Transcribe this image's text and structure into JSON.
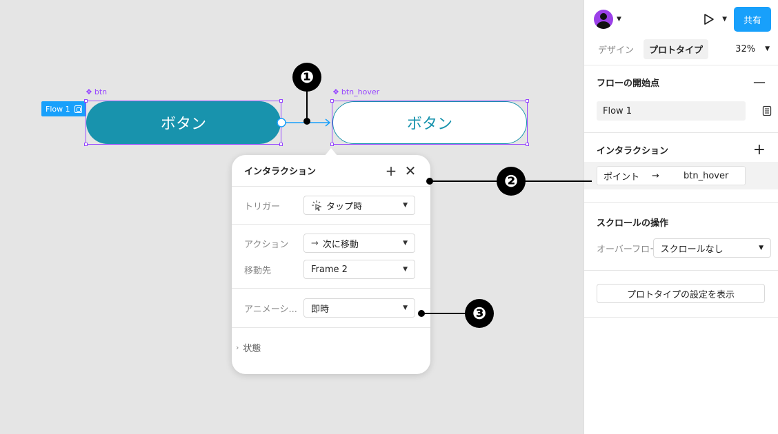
{
  "canvas": {
    "flow_tag": "Flow 1",
    "components": [
      {
        "name": "btn",
        "label": "ボタン"
      },
      {
        "name": "btn_hover",
        "label": "ボタン"
      }
    ],
    "callouts": [
      "❶",
      "❷",
      "❸"
    ]
  },
  "popup": {
    "title": "インタラクション",
    "trigger_label": "トリガー",
    "trigger_value": "タップ時",
    "action_label": "アクション",
    "action_value": "次に移動",
    "destination_label": "移動先",
    "destination_value": "Frame 2",
    "animation_label": "アニメーシ...",
    "animation_value": "即時",
    "state_label": "状態"
  },
  "panel": {
    "tabs": [
      "デザイン",
      "プロトタイプ"
    ],
    "active_tab": "プロトタイプ",
    "zoom": "32%",
    "share_label": "共有",
    "flow_section_title": "フローの開始点",
    "flow_name": "Flow 1",
    "interaction_section_title": "インタラクション",
    "interaction_item": {
      "trigger": "ポイント",
      "target": "btn_hover"
    },
    "scroll_section_title": "スクロールの操作",
    "overflow_label": "オーバーフロー",
    "overflow_value": "スクロールなし",
    "settings_button": "プロトタイプの設定を表示"
  },
  "colors": {
    "accent": "#18a0fb",
    "component": "#9747ff",
    "button_fill": "#1893ad"
  }
}
